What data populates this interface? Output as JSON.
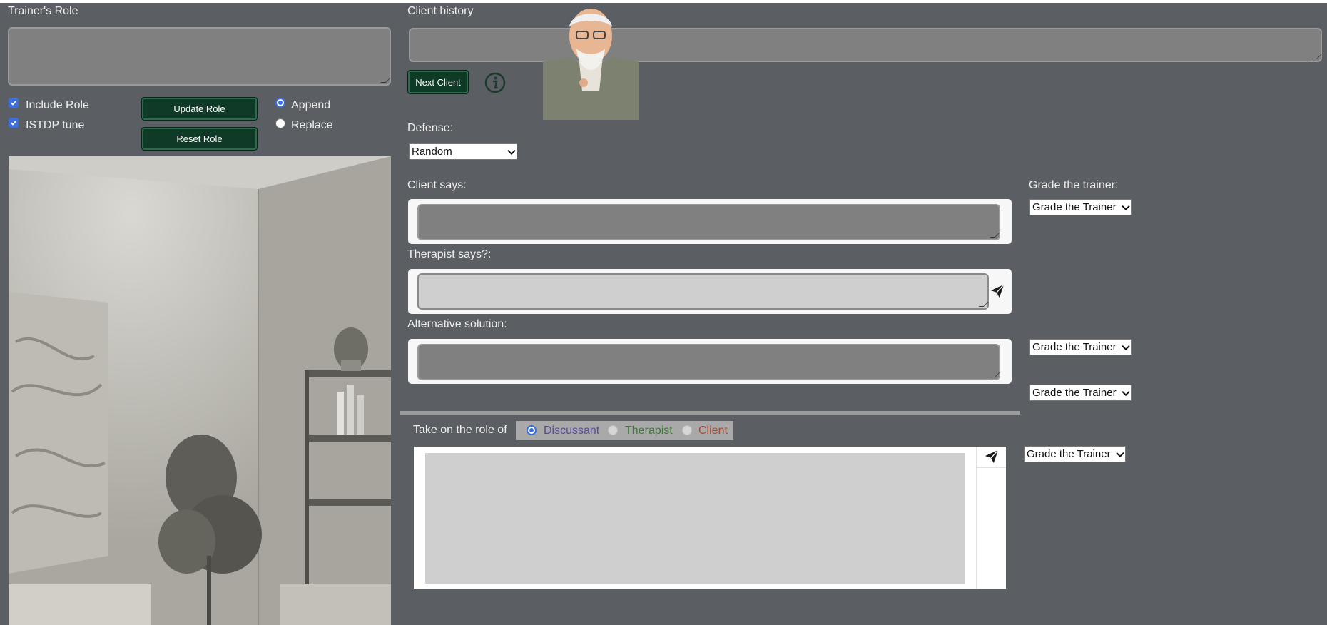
{
  "left": {
    "trainer_role_label": "Trainer's Role",
    "trainer_role_value": "",
    "include_role_label": "Include Role",
    "include_role_checked": true,
    "istdp_tune_label": "ISTDP tune",
    "istdp_tune_checked": true,
    "update_role_button": "Update Role",
    "reset_role_button": "Reset Role",
    "append_label": "Append",
    "replace_label": "Replace",
    "mode_selected": "Append"
  },
  "history": {
    "label": "Client history",
    "value": "",
    "next_client_button": "Next Client",
    "info_icon": "info-circle-icon"
  },
  "defense": {
    "label": "Defense:",
    "selected": "Random"
  },
  "dialog": {
    "client_says_label": "Client says:",
    "client_says_value": "",
    "therapist_says_label": "Therapist says?:",
    "therapist_says_value": "",
    "alternative_label": "Alternative solution:",
    "alternative_value": "",
    "send_icon": "paper-plane-icon"
  },
  "grading": {
    "heading": "Grade the trainer:",
    "select_1": "Grade the Trainer",
    "select_2": "Grade the Trainer",
    "select_3": "Grade the Trainer",
    "select_4": "Grade the Trainer"
  },
  "role_play": {
    "label": "Take on the role of",
    "options": [
      "Discussant",
      "Therapist",
      "Client"
    ],
    "selected": "Discussant",
    "colors": {
      "Discussant": "#5a4a9a",
      "Therapist": "#3f7a3a",
      "Client": "#a64a32"
    },
    "message_value": ""
  },
  "colors": {
    "background": "#5b5f63",
    "button_green": "#0f3a27",
    "accent_blue": "#3a6fe0"
  }
}
